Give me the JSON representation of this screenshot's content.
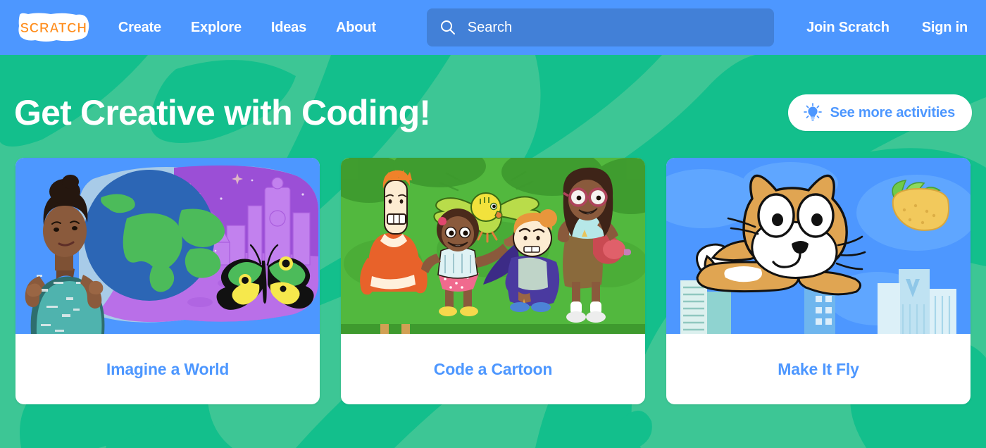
{
  "navbar": {
    "logo_text": "SCRATCH",
    "logo_icon": "scratch-logo",
    "links": [
      {
        "label": "Create"
      },
      {
        "label": "Explore"
      },
      {
        "label": "Ideas"
      },
      {
        "label": "About"
      }
    ],
    "search": {
      "icon": "search-icon",
      "placeholder": "Search",
      "value": ""
    },
    "auth": [
      {
        "label": "Join Scratch"
      },
      {
        "label": "Sign in"
      }
    ],
    "colors": {
      "background": "#4D97FF",
      "search_background": "#4280D7",
      "text": "#FFFFFF"
    }
  },
  "hero": {
    "title": "Get Creative with Coding!",
    "see_more": {
      "label": "See more activities",
      "icon": "lightbulb-icon",
      "text_color": "#4D97FF",
      "background": "#FFFFFF"
    },
    "colors": {
      "background": "#3DC695",
      "blob": "#13BF8C"
    }
  },
  "cards": [
    {
      "title": "Imagine a World",
      "thumb_name": "imagine-a-world-thumbnail",
      "thumb_background": "#4D97FF",
      "thumb_alt": "Woman pointing at an illustrated globe with a purple space city and a green butterfly"
    },
    {
      "title": "Code a Cartoon",
      "thumb_name": "code-a-cartoon-thumbnail",
      "thumb_background": "#4CAF3F",
      "thumb_alt": "Four cartoon characters on a green background with a flying yellow-green parakeet"
    },
    {
      "title": "Make It Fly",
      "thumb_name": "make-it-fly-thumbnail",
      "thumb_background": "#4D97FF",
      "thumb_alt": "The Scratch Cat flying over a city skyline with a taco"
    }
  ],
  "card_title_color": "#4D97FF"
}
